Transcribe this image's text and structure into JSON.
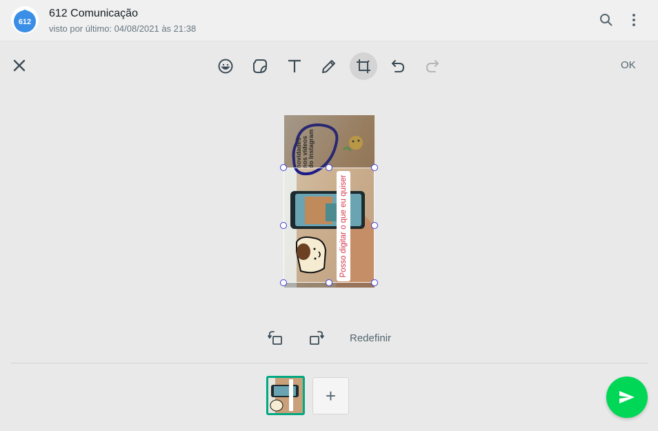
{
  "header": {
    "avatar_text": "612",
    "chat_name": "612 Comunicação",
    "last_seen": "visto por último: 04/08/2021 às 21:38",
    "search_icon": "search-icon",
    "menu_icon": "more-vertical-icon"
  },
  "toolbar": {
    "close_icon": "close-icon",
    "tools": [
      {
        "name": "emoji",
        "icon": "emoji-icon"
      },
      {
        "name": "sticker",
        "icon": "sticker-icon"
      },
      {
        "name": "text",
        "icon": "text-icon"
      },
      {
        "name": "draw",
        "icon": "pencil-icon"
      },
      {
        "name": "crop",
        "icon": "crop-icon",
        "active": true
      },
      {
        "name": "undo",
        "icon": "undo-icon"
      },
      {
        "name": "redo",
        "icon": "redo-icon",
        "disabled": true
      }
    ],
    "ok_label": "OK"
  },
  "image": {
    "overlay_text": "Posso digitar o que eu quiser",
    "overlay_text_color": "#d4334a",
    "drawn_text": "novidades nos vídeos do Instagram"
  },
  "crop_controls": {
    "rotate_left_icon": "rotate-left-icon",
    "rotate_right_icon": "rotate-right-icon",
    "reset_label": "Redefinir"
  },
  "footer": {
    "add_label": "+",
    "send_icon": "send-icon"
  },
  "colors": {
    "accent": "#00a884",
    "send": "#00d756",
    "crop_handle": "#3b3bd6"
  }
}
